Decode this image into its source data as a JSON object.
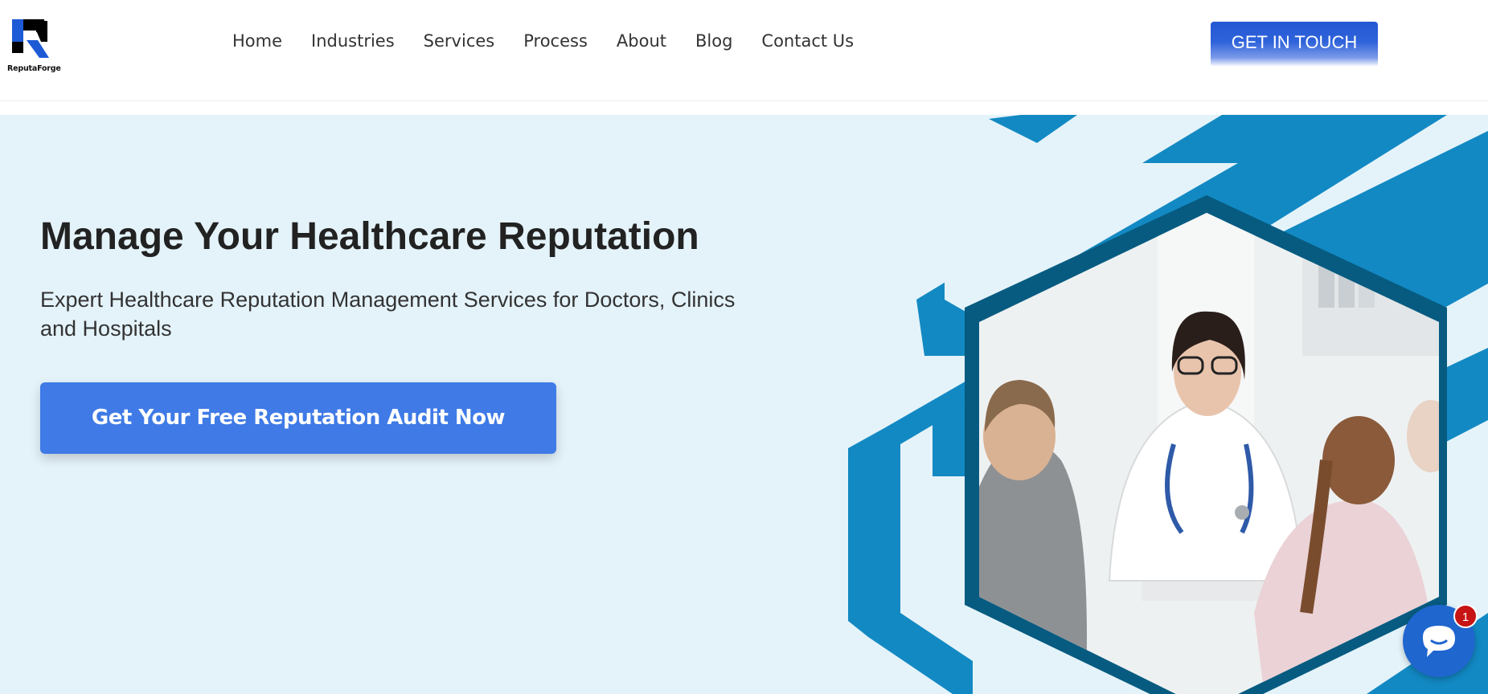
{
  "brand": {
    "name": "ReputaForge"
  },
  "nav": {
    "items": [
      {
        "label": "Home"
      },
      {
        "label": "Industries"
      },
      {
        "label": "Services"
      },
      {
        "label": "Process"
      },
      {
        "label": "About"
      },
      {
        "label": "Blog"
      },
      {
        "label": "Contact Us"
      }
    ]
  },
  "header": {
    "cta_label": "GET IN TOUCH"
  },
  "hero": {
    "title": "Manage Your Healthcare Reputation",
    "subtitle": "Expert Healthcare Reputation Management Services for Doctors, Clinics and Hospitals",
    "cta_label": "Get Your Free Reputation Audit Now",
    "image_alt": "Smiling doctor in white coat with stethoscope talking to a man and a girl at a clinic desk"
  },
  "chat": {
    "icon": "chat-bubble-icon",
    "badge_count": "1"
  },
  "colors": {
    "primary": "#3f7ae6",
    "header_cta": "#2358d4",
    "hero_bg": "#e4f3fa",
    "hex_stripe": "#1289c3",
    "hex_frame": "#075b80",
    "badge": "#c71414"
  }
}
